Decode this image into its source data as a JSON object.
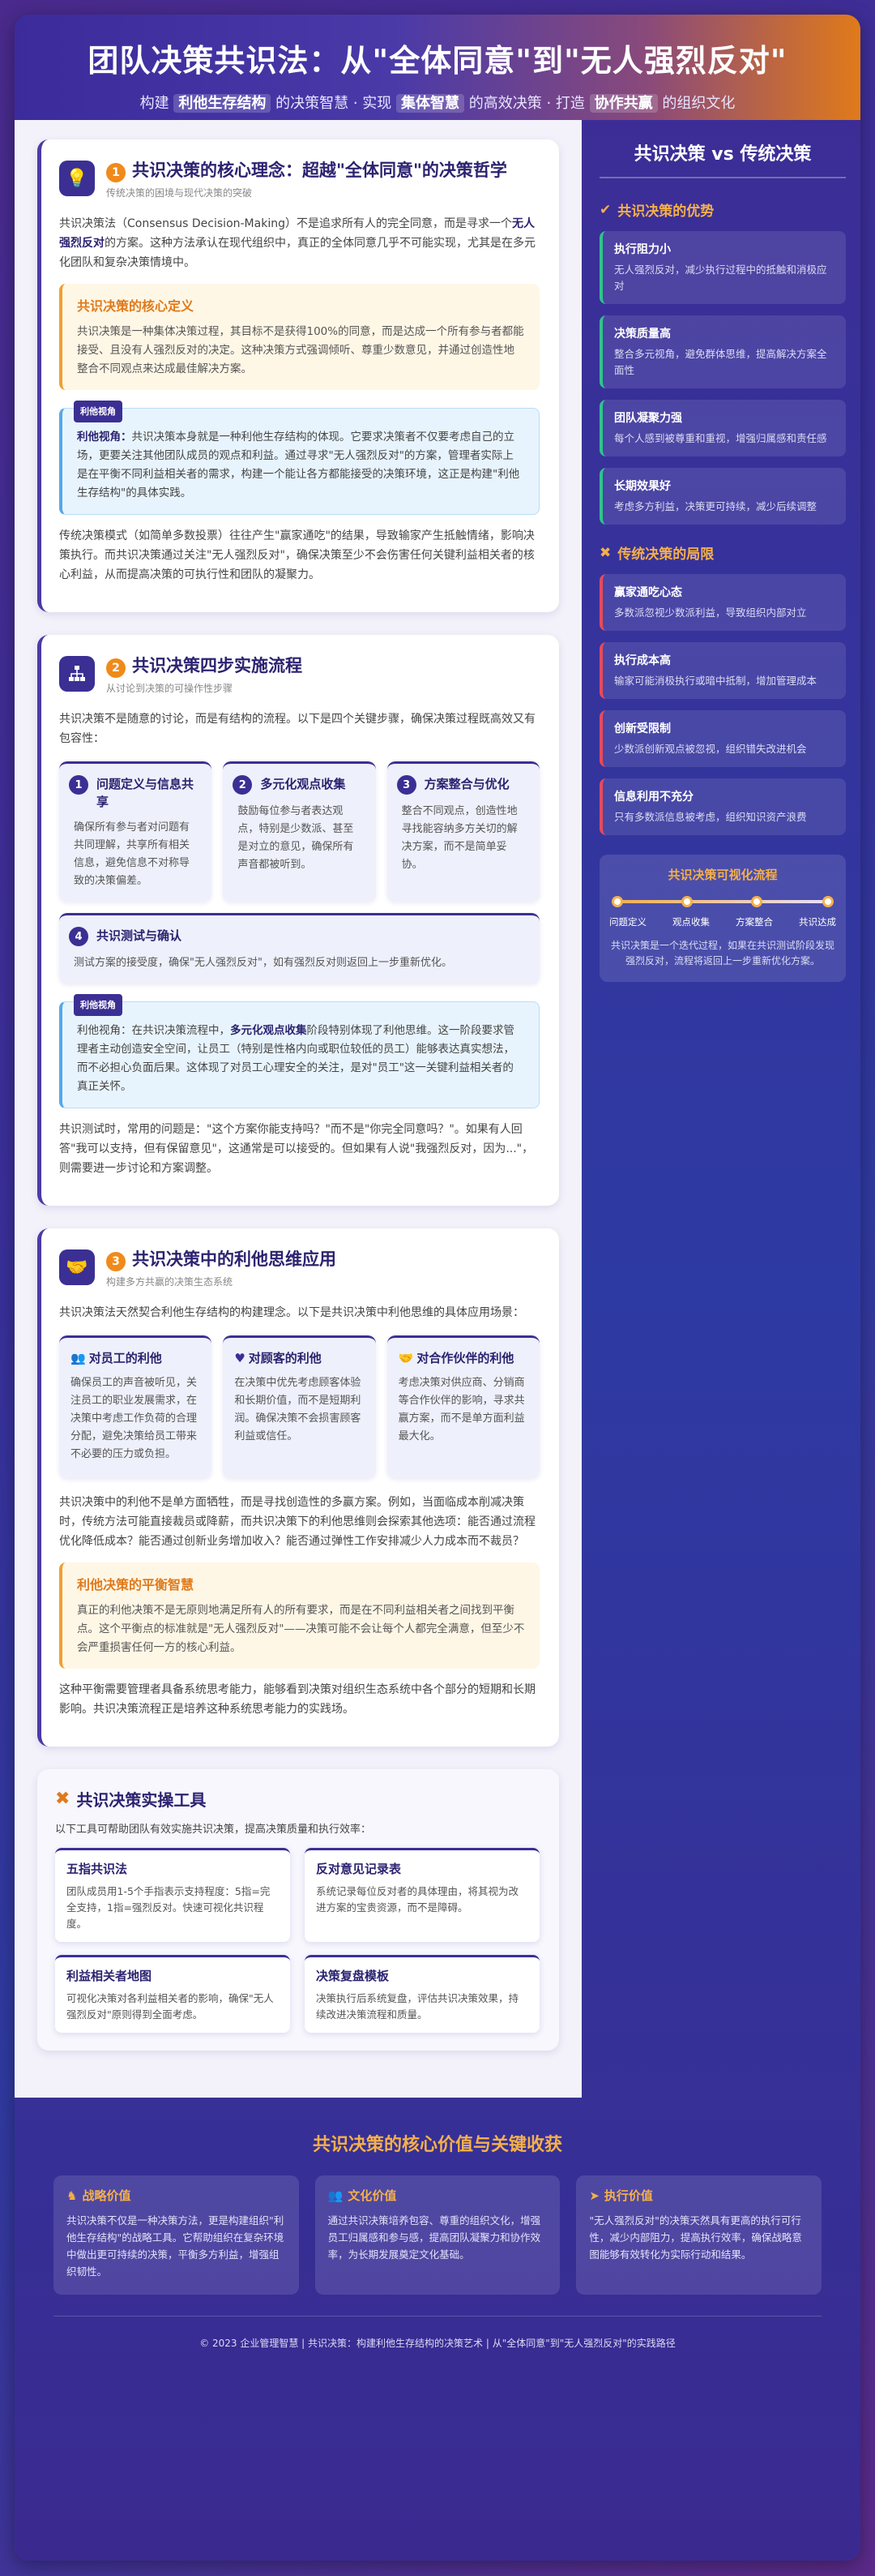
{
  "header": {
    "title": "团队决策共识法：从\"全体同意\"到\"无人强烈反对\"",
    "sub_1": "构建",
    "sub_k1": "利他生存结构",
    "sub_2": "的决策智慧 · 实现",
    "sub_k2": "集体智慧",
    "sub_3": "的高效决策 · 打造",
    "sub_k3": "协作共赢",
    "sub_4": "的组织文化"
  },
  "s1": {
    "num": "1",
    "title": "共识决策的核心理念：超越\"全体同意\"的决策哲学",
    "sub": "传统决策的困境与现代决策的突破",
    "p1a": "共识决策法（Consensus Decision-Making）不是追求所有人的完全同意，而是寻求一个",
    "p1b": "无人强烈反对",
    "p1c": "的方案。这种方法承认在现代组织中，真正的全体同意几乎不可能实现，尤其是在多元化团队和复杂决策情境中。",
    "def_title": "共识决策的核心定义",
    "def_body": "共识决策是一种集体决策过程，其目标不是获得100%的同意，而是达成一个所有参与者都能接受、且没有人强烈反对的决定。这种决策方式强调倾听、尊重少数意见，并通过创造性地整合不同观点来达成最佳解决方案。",
    "tag": "利他视角",
    "blue_label": "利他视角：",
    "blue_body": "共识决策本身就是一种利他生存结构的体现。它要求决策者不仅要考虑自己的立场，更要关注其他团队成员的观点和利益。通过寻求\"无人强烈反对\"的方案，管理者实际上是在平衡不同利益相关者的需求，构建一个能让各方都能接受的决策环境，这正是构建\"利他生存结构\"的具体实践。",
    "p2": "传统决策模式（如简单多数投票）往往产生\"赢家通吃\"的结果，导致输家产生抵触情绪，影响决策执行。而共识决策通过关注\"无人强烈反对\"，确保决策至少不会伤害任何关键利益相关者的核心利益，从而提高决策的可执行性和团队的凝聚力。"
  },
  "s2": {
    "num": "2",
    "title": "共识决策四步实施流程",
    "sub": "从讨论到决策的可操作性步骤",
    "intro": "共识决策不是随意的讨论，而是有结构的流程。以下是四个关键步骤，确保决策过程既高效又有包容性：",
    "steps": [
      {
        "n": "1",
        "t": "问题定义与信息共享",
        "b": "确保所有参与者对问题有共同理解，共享所有相关信息，避免信息不对称导致的决策偏差。"
      },
      {
        "n": "2",
        "t": "多元化观点收集",
        "b": "鼓励每位参与者表达观点，特别是少数派、甚至是对立的意见，确保所有声音都被听到。"
      },
      {
        "n": "3",
        "t": "方案整合与优化",
        "b": "整合不同观点，创造性地寻找能容纳多方关切的解决方案，而不是简单妥协。"
      },
      {
        "n": "4",
        "t": "共识测试与确认",
        "b": "测试方案的接受度，确保\"无人强烈反对\"，如有强烈反对则返回上一步重新优化。"
      }
    ],
    "tag": "利他视角",
    "blue_a": "利他视角：在共识决策流程中，",
    "blue_b": "多元化观点收集",
    "blue_c": "阶段特别体现了利他思维。这一阶段要求管理者主动创造安全空间，让员工（特别是性格内向或职位较低的员工）能够表达真实想法，而不必担心负面后果。这体现了对员工心理安全的关注，是对\"员工\"这一关键利益相关者的真正关怀。",
    "p3": "共识测试时，常用的问题是：\"这个方案你能支持吗？\"而不是\"你完全同意吗？\"。如果有人回答\"我可以支持，但有保留意见\"，这通常是可以接受的。但如果有人说\"我强烈反对，因为...\"，则需要进一步讨论和方案调整。"
  },
  "s3": {
    "num": "3",
    "title": "共识决策中的利他思维应用",
    "sub": "构建多方共赢的决策生态系统",
    "intro": "共识决策法天然契合利他生存结构的构建理念。以下是共识决策中利他思维的具体应用场景：",
    "cards": [
      {
        "t": "对员工的利他",
        "b": "确保员工的声音被听见，关注员工的职业发展需求，在决策中考虑工作负荷的合理分配，避免决策给员工带来不必要的压力或负担。"
      },
      {
        "t": "对顾客的利他",
        "b": "在决策中优先考虑顾客体验和长期价值，而不是短期利润。确保决策不会损害顾客利益或信任。"
      },
      {
        "t": "对合作伙伴的利他",
        "b": "考虑决策对供应商、分销商等合作伙伴的影响，寻求共赢方案，而不是单方面利益最大化。"
      }
    ],
    "p1": "共识决策中的利他不是单方面牺牲，而是寻找创造性的多赢方案。例如，当面临成本削减决策时，传统方法可能直接裁员或降薪，而共识决策下的利他思维则会探索其他选项：能否通过流程优化降低成本？能否通过创新业务增加收入？能否通过弹性工作安排减少人力成本而不裁员？",
    "bal_title": "利他决策的平衡智慧",
    "bal_body": "真正的利他决策不是无原则地满足所有人的所有要求，而是在不同利益相关者之间找到平衡点。这个平衡点的标准就是\"无人强烈反对\"——决策可能不会让每个人都完全满意，但至少不会严重损害任何一方的核心利益。",
    "p2": "这种平衡需要管理者具备系统思考能力，能够看到决策对组织生态系统中各个部分的短期和长期影响。共识决策流程正是培养这种系统思考能力的实践场。"
  },
  "tools": {
    "title": "共识决策实操工具",
    "intro": "以下工具可帮助团队有效实施共识决策，提高决策质量和执行效率：",
    "items": [
      {
        "t": "五指共识法",
        "b": "团队成员用1-5个手指表示支持程度：5指=完全支持，1指=强烈反对。快速可视化共识程度。"
      },
      {
        "t": "反对意见记录表",
        "b": "系统记录每位反对者的具体理由，将其视为改进方案的宝贵资源，而不是障碍。"
      },
      {
        "t": "利益相关者地图",
        "b": "可视化决策对各利益相关者的影响，确保\"无人强烈反对\"原则得到全面考虑。"
      },
      {
        "t": "决策复盘模板",
        "b": "决策执行后系统复盘，评估共识决策效果，持续改进决策流程和质量。"
      }
    ]
  },
  "side": {
    "title": "共识决策 vs 传统决策",
    "adv_title": "共识决策的优势",
    "adv": [
      {
        "t": "执行阻力小",
        "b": "无人强烈反对，减少执行过程中的抵触和消极应对"
      },
      {
        "t": "决策质量高",
        "b": "整合多元视角，避免群体思维，提高解决方案全面性"
      },
      {
        "t": "团队凝聚力强",
        "b": "每个人感到被尊重和重视，增强归属感和责任感"
      },
      {
        "t": "长期效果好",
        "b": "考虑多方利益，决策更可持续，减少后续调整"
      }
    ],
    "lim_title": "传统决策的局限",
    "lim": [
      {
        "t": "赢家通吃心态",
        "b": "多数派忽视少数派利益，导致组织内部对立"
      },
      {
        "t": "执行成本高",
        "b": "输家可能消极执行或暗中抵制，增加管理成本"
      },
      {
        "t": "创新受限制",
        "b": "少数派创新观点被忽视，组织错失改进机会"
      },
      {
        "t": "信息利用不充分",
        "b": "只有多数派信息被考虑，组织知识资产浪费"
      }
    ],
    "flow_title": "共识决策可视化流程",
    "flow_labels": [
      "问题定义",
      "观点收集",
      "方案整合",
      "共识达成"
    ],
    "flow_desc": "共识决策是一个迭代过程，如果在共识测试阶段发现强烈反对，流程将返回上一步重新优化方案。"
  },
  "footer": {
    "title": "共识决策的核心价值与关键收获",
    "cards": [
      {
        "t": "战略价值",
        "b": "共识决策不仅是一种决策方法，更是构建组织\"利他生存结构\"的战略工具。它帮助组织在复杂环境中做出更可持续的决策，平衡多方利益，增强组织韧性。"
      },
      {
        "t": "文化价值",
        "b": "通过共识决策培养包容、尊重的组织文化，增强员工归属感和参与感，提高团队凝聚力和协作效率，为长期发展奠定文化基础。"
      },
      {
        "t": "执行价值",
        "b": "\"无人强烈反对\"的决策天然具有更高的执行可行性，减少内部阻力，提高执行效率，确保战略意图能够有效转化为实际行动和结果。"
      }
    ],
    "copy": "© 2023 企业管理智慧 | 共识决策：构建利他生存结构的决策艺术 | 从\"全体同意\"到\"无人强烈反对\"的实践路径"
  }
}
